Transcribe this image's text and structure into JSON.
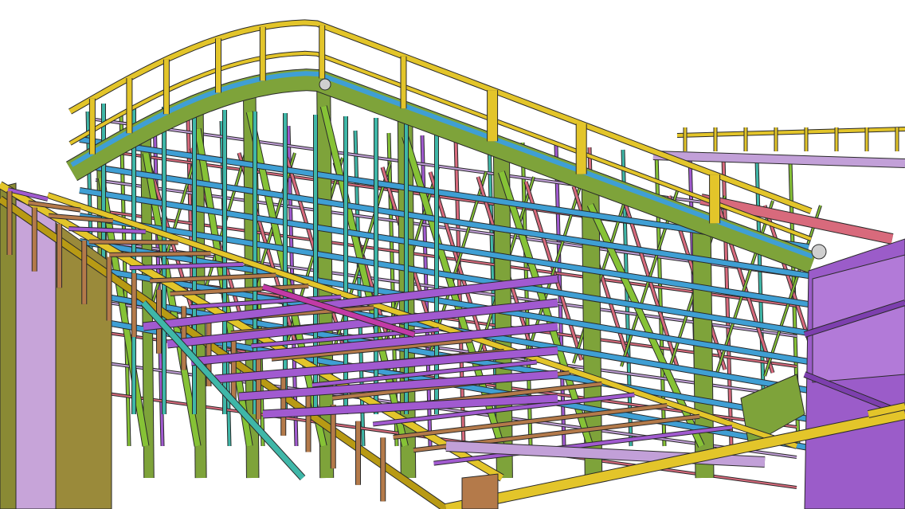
{
  "scene": {
    "subject": "steel-structure-3d-model",
    "colors": {
      "background": "#ffffff",
      "rail": "#e3c52a",
      "rail_dark": "#b89a14",
      "chord": "#7ea33a",
      "chord_dark": "#5e7f26",
      "purlin_blue": "#3f9fd4",
      "teal": "#3fb7a8",
      "diagonal_green": "#86c236",
      "brace_pink": "#d86a7c",
      "purple": "#a15ad0",
      "purple_panel": "#9b5cc9",
      "lilac": "#c2a0d8",
      "brown": "#b47a4a",
      "olive": "#8a8a34",
      "magenta": "#c23aa6",
      "edge": "#2a2a2a"
    }
  }
}
